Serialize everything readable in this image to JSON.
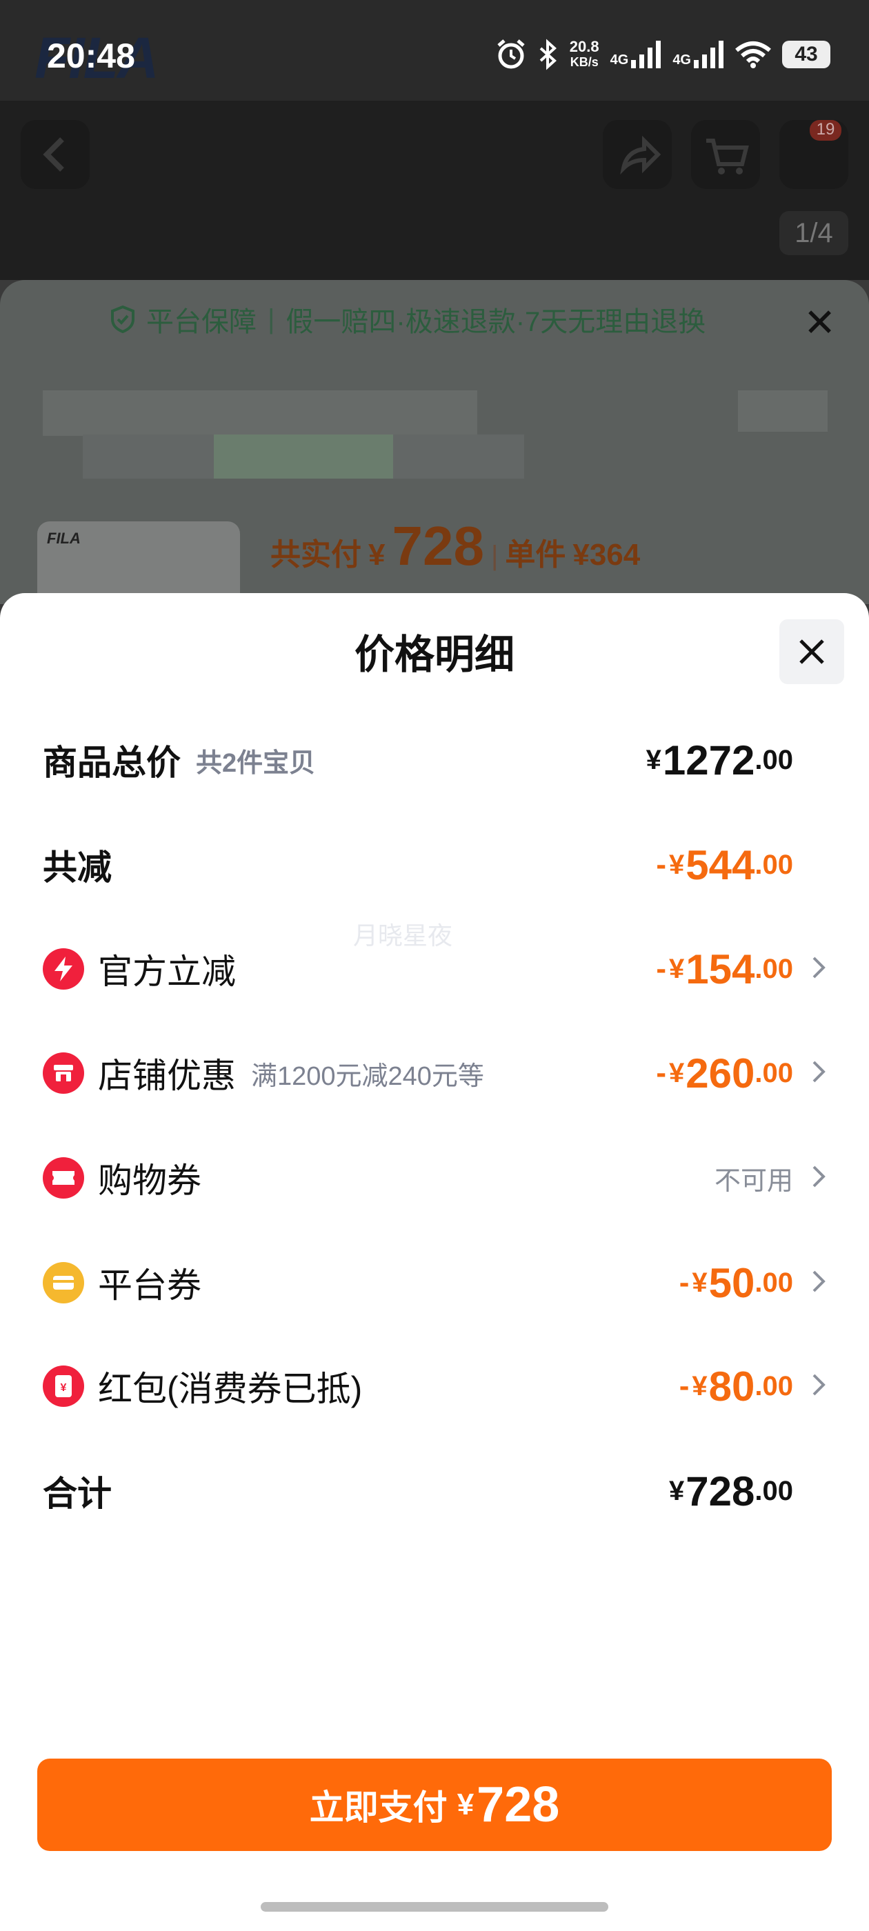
{
  "status_bar": {
    "time": "20:48",
    "network_speed": "20.8",
    "network_speed_unit": "KB/s",
    "signal1": "4G",
    "signal2": "4G",
    "battery": "43",
    "icons": [
      "alarm-icon",
      "bluetooth-icon",
      "signal-icon",
      "wifi-icon",
      "battery-icon"
    ]
  },
  "background": {
    "logo": "FILA",
    "cart_badge": "19",
    "pager": "1/4",
    "guarantee": {
      "title": "平台保障",
      "divider": "|",
      "items": "假一赔四·极速退款·7天无理由退换"
    },
    "thumb_logo": "FILA",
    "total_label": "共实付",
    "total_yen": "¥",
    "total_value": "728",
    "unit_label": "单件",
    "unit_price": "¥364"
  },
  "modal": {
    "title": "价格明细",
    "rows": [
      {
        "label": "商品总价",
        "sub": "共2件宝贝",
        "prefix": "",
        "yen": "¥",
        "int": "1272",
        "dec": ".00"
      },
      {
        "label": "共减",
        "sub": "",
        "prefix": "-",
        "yen": "¥",
        "int": "544",
        "dec": ".00"
      },
      {
        "label": "官方立减",
        "sub": "",
        "prefix": "-",
        "yen": "¥",
        "int": "154",
        "dec": ".00",
        "icon": "lightning-icon"
      },
      {
        "label": "店铺优惠",
        "sub": "满1200元减240元等",
        "prefix": "-",
        "yen": "¥",
        "int": "260",
        "dec": ".00",
        "icon": "shop-icon"
      },
      {
        "label": "购物券",
        "sub": "",
        "value_text": "不可用",
        "icon": "ticket-icon"
      },
      {
        "label": "平台券",
        "sub": "",
        "prefix": "-",
        "yen": "¥",
        "int": "50",
        "dec": ".00",
        "icon": "coupon-icon"
      },
      {
        "label": "红包(消费券已抵)",
        "sub": "",
        "prefix": "-",
        "yen": "¥",
        "int": "80",
        "dec": ".00",
        "icon": "red-packet-icon"
      },
      {
        "label": "合计",
        "sub": "",
        "prefix": "",
        "yen": "¥",
        "int": "728",
        "dec": ".00"
      }
    ],
    "watermark": "月晓星夜"
  },
  "pay_button": {
    "label": "立即支付",
    "yen": "¥",
    "amount": "728"
  },
  "colors": {
    "accent": "#ff6a0a",
    "discount": "#f56a0f",
    "icon_red": "#f0203c",
    "icon_yellow": "#f5b82e"
  }
}
